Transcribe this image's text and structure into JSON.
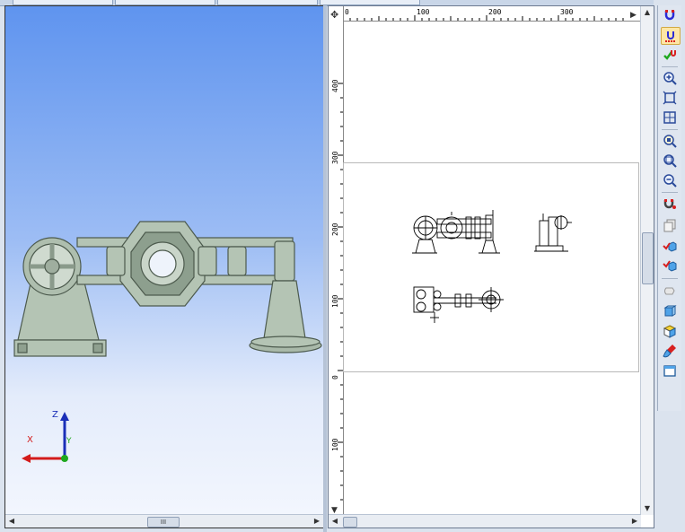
{
  "ruler": {
    "top_ticks": [
      "0",
      "100",
      "200",
      "300"
    ],
    "left_ticks": [
      "400",
      "300",
      "200",
      "100",
      "0",
      "100"
    ]
  },
  "scrollbar": {
    "thumb_grip": "III",
    "left_arrow": "◀",
    "right_arrow": "▶",
    "up_arrow": "▲",
    "down_arrow": "▼"
  },
  "triad": {
    "x": "X",
    "y": "Y",
    "z": "Z"
  },
  "colors": {
    "model": "#b4c4b4",
    "model_dark": "#6f7f70",
    "axis_x": "#d31b1b",
    "axis_y": "#1fa81f",
    "axis_z": "#1a2fb8"
  },
  "toolbar": [
    {
      "icon": "magnet-snap-icon",
      "active": false
    },
    {
      "icon": "pin-magnet-icon",
      "active": true
    },
    {
      "icon": "check-magnet-icon",
      "active": false
    },
    {
      "icon": "zoom-in-icon",
      "active": false
    },
    {
      "icon": "zoom-fit-icon",
      "active": false
    },
    {
      "icon": "zoom-window-icon",
      "active": false
    },
    {
      "icon": "zoom-page-icon",
      "active": false
    },
    {
      "icon": "zoom-prev-icon",
      "active": false
    },
    {
      "icon": "zoom-out-icon",
      "active": false
    },
    {
      "icon": "magnet-red-icon",
      "active": false
    },
    {
      "icon": "copy-sheets-icon",
      "active": false
    },
    {
      "icon": "check-cube-icon",
      "active": false
    },
    {
      "icon": "check-cube-2-icon",
      "active": false
    },
    {
      "icon": "hand-icon",
      "active": false
    },
    {
      "icon": "cube-front-icon",
      "active": false
    },
    {
      "icon": "cube-iso-icon",
      "active": false
    },
    {
      "icon": "brush-icon",
      "active": false
    },
    {
      "icon": "window-icon",
      "active": false
    }
  ]
}
